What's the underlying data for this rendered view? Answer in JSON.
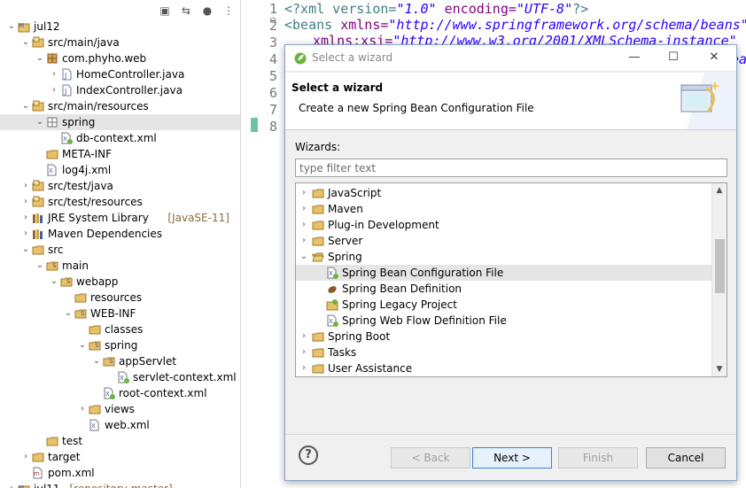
{
  "explorer": {
    "items": [
      {
        "label": "jul12",
        "deco": "",
        "depth": 0,
        "twist": "open",
        "icon": "maven-project-icon"
      },
      {
        "label": "src/main/java",
        "deco": "",
        "depth": 1,
        "twist": "open",
        "icon": "source-folder-icon"
      },
      {
        "label": "com.phyho.web",
        "deco": "",
        "depth": 2,
        "twist": "open",
        "icon": "package-icon"
      },
      {
        "label": "HomeController.java",
        "deco": "",
        "depth": 3,
        "twist": "closed",
        "icon": "java-file-icon"
      },
      {
        "label": "IndexController.java",
        "deco": "",
        "depth": 3,
        "twist": "closed",
        "icon": "java-file-icon"
      },
      {
        "label": "src/main/resources",
        "deco": "",
        "depth": 1,
        "twist": "open",
        "icon": "source-folder-icon"
      },
      {
        "label": "spring",
        "deco": "",
        "depth": 2,
        "twist": "open",
        "icon": "package-empty-icon",
        "selected": true
      },
      {
        "label": "db-context.xml",
        "deco": "",
        "depth": 3,
        "twist": "",
        "icon": "spring-xml-icon"
      },
      {
        "label": "META-INF",
        "deco": "",
        "depth": 2,
        "twist": "",
        "icon": "folder-icon"
      },
      {
        "label": "log4j.xml",
        "deco": "",
        "depth": 2,
        "twist": "",
        "icon": "xml-file-icon"
      },
      {
        "label": "src/test/java",
        "deco": "",
        "depth": 1,
        "twist": "closed",
        "icon": "source-folder-icon"
      },
      {
        "label": "src/test/resources",
        "deco": "",
        "depth": 1,
        "twist": "closed",
        "icon": "source-folder-icon"
      },
      {
        "label": "JRE System Library",
        "deco": "[JavaSE-11]",
        "depth": 1,
        "twist": "closed",
        "icon": "library-icon"
      },
      {
        "label": "Maven Dependencies",
        "deco": "",
        "depth": 1,
        "twist": "closed",
        "icon": "library-icon"
      },
      {
        "label": "src",
        "deco": "",
        "depth": 1,
        "twist": "open",
        "icon": "folder-icon"
      },
      {
        "label": "main",
        "deco": "",
        "depth": 2,
        "twist": "open",
        "icon": "spring-folder-icon"
      },
      {
        "label": "webapp",
        "deco": "",
        "depth": 3,
        "twist": "open",
        "icon": "spring-folder-icon"
      },
      {
        "label": "resources",
        "deco": "",
        "depth": 4,
        "twist": "",
        "icon": "folder-icon"
      },
      {
        "label": "WEB-INF",
        "deco": "",
        "depth": 4,
        "twist": "open",
        "icon": "spring-folder-icon"
      },
      {
        "label": "classes",
        "deco": "",
        "depth": 5,
        "twist": "",
        "icon": "folder-icon"
      },
      {
        "label": "spring",
        "deco": "",
        "depth": 5,
        "twist": "open",
        "icon": "spring-folder-icon"
      },
      {
        "label": "appServlet",
        "deco": "",
        "depth": 6,
        "twist": "open",
        "icon": "spring-folder-icon"
      },
      {
        "label": "servlet-context.xml",
        "deco": "",
        "depth": 7,
        "twist": "",
        "icon": "spring-xml-icon"
      },
      {
        "label": "root-context.xml",
        "deco": "",
        "depth": 6,
        "twist": "",
        "icon": "spring-xml-icon"
      },
      {
        "label": "views",
        "deco": "",
        "depth": 5,
        "twist": "closed",
        "icon": "folder-icon"
      },
      {
        "label": "web.xml",
        "deco": "",
        "depth": 5,
        "twist": "",
        "icon": "xml-file-icon"
      },
      {
        "label": "test",
        "deco": "",
        "depth": 2,
        "twist": "",
        "icon": "folder-icon"
      },
      {
        "label": "target",
        "deco": "",
        "depth": 1,
        "twist": "closed",
        "icon": "folder-icon"
      },
      {
        "label": "pom.xml",
        "deco": "",
        "depth": 1,
        "twist": "",
        "icon": "maven-pom-icon"
      },
      {
        "label": "jul11",
        "deco": "[repository master]",
        "depth": 0,
        "twist": "closed",
        "icon": "maven-project-icon"
      }
    ]
  },
  "editor": {
    "lines": [
      "1",
      "2",
      "3",
      "4",
      "5",
      "6",
      "7",
      "8"
    ],
    "code": {
      "l1_a": "<?xml version=",
      "l1_b": "\"1.0\"",
      "l1_c": " encoding=",
      "l1_d": "\"UTF-8\"",
      "l1_e": "?>",
      "l2_a": "<beans",
      "l2_b": " xmlns=",
      "l2_c": "\"http://www.springframework.org/schema/beans\"",
      "l3_a": "xmlns:xsi=",
      "l3_b": "\"http://www.w3.org/2001/XMLSchema-instance\"",
      "l4_tail": "ea"
    }
  },
  "dialog": {
    "window_title": "Select a wizard",
    "header_title": "Select a wizard",
    "header_desc": "Create a new Spring Bean Configuration File",
    "wizards_label": "Wizards:",
    "filter_placeholder": "type filter text",
    "list": [
      {
        "label": "JavaScript",
        "depth": 0,
        "twist": "closed",
        "icon": "folder-icon"
      },
      {
        "label": "Maven",
        "depth": 0,
        "twist": "closed",
        "icon": "folder-icon"
      },
      {
        "label": "Plug-in Development",
        "depth": 0,
        "twist": "closed",
        "icon": "folder-icon"
      },
      {
        "label": "Server",
        "depth": 0,
        "twist": "closed",
        "icon": "folder-icon"
      },
      {
        "label": "Spring",
        "depth": 0,
        "twist": "open",
        "icon": "folder-open-icon"
      },
      {
        "label": "Spring Bean Configuration File",
        "depth": 1,
        "twist": "",
        "icon": "spring-xml-icon",
        "selected": true
      },
      {
        "label": "Spring Bean Definition",
        "depth": 1,
        "twist": "",
        "icon": "bean-icon"
      },
      {
        "label": "Spring Legacy Project",
        "depth": 1,
        "twist": "",
        "icon": "spring-project-icon"
      },
      {
        "label": "Spring Web Flow Definition File",
        "depth": 1,
        "twist": "",
        "icon": "spring-xml-icon"
      },
      {
        "label": "Spring Boot",
        "depth": 0,
        "twist": "closed",
        "icon": "folder-icon"
      },
      {
        "label": "Tasks",
        "depth": 0,
        "twist": "closed",
        "icon": "folder-icon"
      },
      {
        "label": "User Assistance",
        "depth": 0,
        "twist": "closed",
        "icon": "folder-icon"
      }
    ],
    "buttons": {
      "back": "< Back",
      "next": "Next >",
      "finish": "Finish",
      "cancel": "Cancel",
      "help": "?"
    }
  }
}
